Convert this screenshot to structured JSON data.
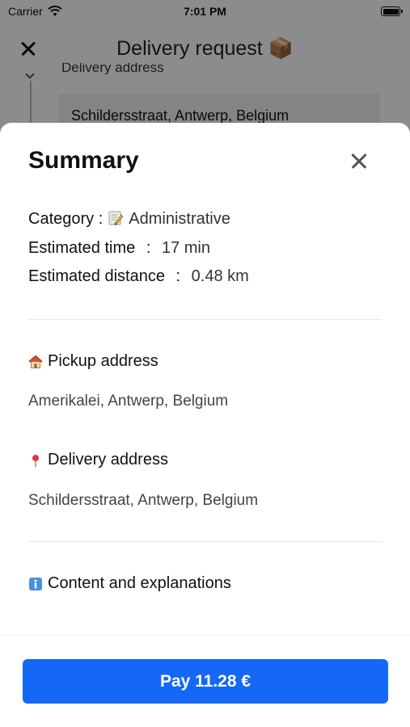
{
  "status_bar": {
    "carrier": "Carrier",
    "time": "7:01 PM"
  },
  "background": {
    "title": "Delivery request",
    "title_emoji": "📦",
    "partial_label": "Delivery address",
    "field_value": "Schildersstraat, Antwerp, Belgium"
  },
  "sheet": {
    "title": "Summary",
    "category_label": "Category :",
    "category_icon": "memo-icon",
    "category_value": "Administrative",
    "time_label": "Estimated time",
    "time_separator": ":",
    "time_value": "17 min",
    "distance_label": "Estimated distance",
    "distance_separator": ":",
    "distance_value": "0.48 km",
    "pickup": {
      "icon": "house-icon",
      "heading": "Pickup address",
      "address": "Amerikalei, Antwerp, Belgium"
    },
    "delivery": {
      "icon": "pin-icon",
      "heading": "Delivery address",
      "address": "Schildersstraat, Antwerp, Belgium"
    },
    "content": {
      "icon": "info-icon",
      "heading": "Content and explanations"
    },
    "pay_label": "Pay 11.28 €"
  },
  "colors": {
    "accent": "#1468f5",
    "overlay": "rgba(0,0,0,0.45)"
  }
}
